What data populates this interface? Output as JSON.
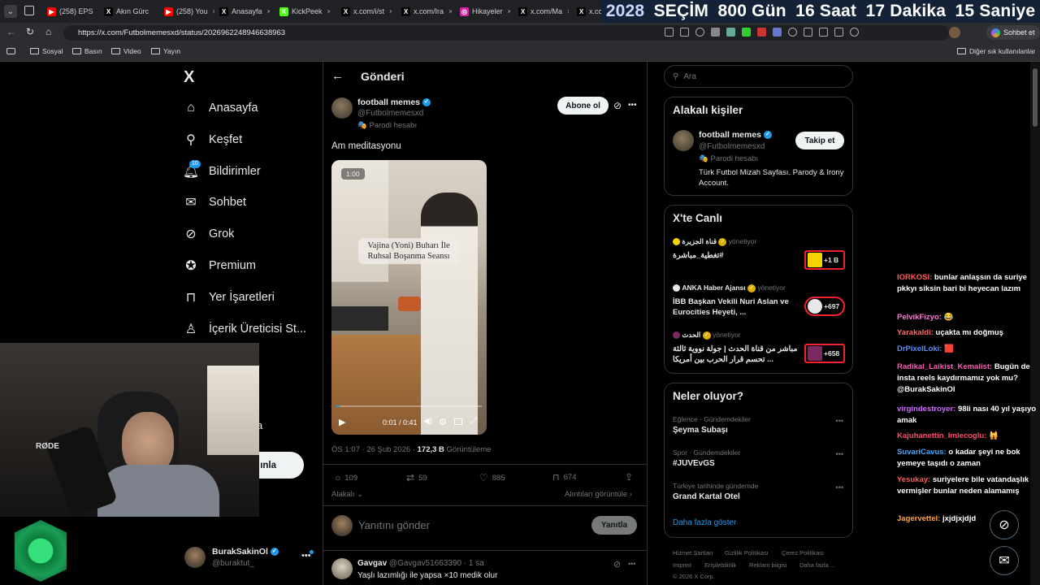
{
  "browser": {
    "tabs": [
      {
        "label": "(258) EPS",
        "fav": "▶",
        "color": "#ff0000"
      },
      {
        "label": "Akın Gürc",
        "fav": "X",
        "color": "#000"
      },
      {
        "label": "(258) You",
        "fav": "▶",
        "color": "#ff0000"
      },
      {
        "label": "Anasayfa",
        "fav": "X",
        "color": "#000"
      },
      {
        "label": "KickPeek",
        "fav": "K",
        "color": "#53fc18"
      },
      {
        "label": "x.com/i/st",
        "fav": "X",
        "color": "#000"
      },
      {
        "label": "x.com/Ira",
        "fav": "X",
        "color": "#000"
      },
      {
        "label": "Hikayeler",
        "fav": "◎",
        "color": "#d6249f"
      },
      {
        "label": "x.com/Ma",
        "fav": "X",
        "color": "#000"
      },
      {
        "label": "x.co",
        "fav": "X",
        "color": "#000"
      }
    ],
    "tab_close": "×",
    "countdown": [
      "2028",
      "SEÇİM",
      "800 Gün",
      "16 Saat",
      "17 Dakika",
      "15 Saniye"
    ],
    "url": "https://x.com/Futbolmemesxd/status/2026962248946638963",
    "copilot_label": "Sohbet et",
    "bookmarks": [
      "Sosyal",
      "Basın",
      "Video",
      "Yayın"
    ],
    "other_bookmarks": "Diğer sık kullanılanlar"
  },
  "nav": {
    "logo": "X",
    "items": [
      {
        "label": "Anasayfa",
        "icon": "home-icon"
      },
      {
        "label": "Keşfet",
        "icon": "search-icon"
      },
      {
        "label": "Bildirimler",
        "icon": "bell-icon",
        "badge": "10"
      },
      {
        "label": "Sohbet",
        "icon": "mail-icon"
      },
      {
        "label": "Grok",
        "icon": "grok-icon"
      },
      {
        "label": "Premium",
        "icon": "premium-icon"
      },
      {
        "label": "Yer İşaretleri",
        "icon": "bookmark-icon"
      },
      {
        "label": "İçerik Üreticisi St...",
        "icon": "creator-icon"
      }
    ],
    "post_button_partial": "ınla",
    "partial_text": "a",
    "account": {
      "name": "BurakSakinOl",
      "handle": "@buraktut_"
    }
  },
  "post_header": {
    "title": "Gönderi"
  },
  "tweet": {
    "author": "football memes",
    "handle": "@Futbolmemesxd",
    "parody": "Parodi hesabı",
    "subscribe": "Abone ol",
    "text": "Am meditasyonu",
    "video": {
      "badge": "1:00",
      "overlay": "Vajina (Yoni) Buharı İle Ruhsal Boşanma Seansı",
      "time": "0:01 / 0:41",
      "progress": 0.02
    },
    "meta_time": "ÖS 1:07 · 26 Şub 2026 · ",
    "meta_views": "172,3 B",
    "meta_views_label": " Görüntüleme",
    "stats": {
      "replies": "109",
      "reposts": "59",
      "likes": "885",
      "bookmarks": "674"
    },
    "related": "Alakalı",
    "quotes": "Alıntıları görüntüle"
  },
  "reply": {
    "placeholder": "Yanıtını gönder",
    "button": "Yanıtla"
  },
  "comment": {
    "name": "Gavgav",
    "handle": "@Gavgav51663390 · 1 sa",
    "text": "Yaşlı lazımlığı ile yapsa ×10 medik olur"
  },
  "sidebar": {
    "search_placeholder": "Ara",
    "related_title": "Alakalı kişiler",
    "related_person": {
      "name": "football memes",
      "handle": "@Futbolmemesxd",
      "parody": "Parodi hesabı",
      "bio": "Türk Futbol Mizah Sayfası. Parody & Irony Account.",
      "follow": "Takip et"
    },
    "live_title": "X'te Canlı",
    "live": [
      {
        "channel": "قناة الجزيرة",
        "role": "yönetiyor",
        "title": "تغطية_مباشرة#",
        "count": "+1 B"
      },
      {
        "channel": "ANKA Haber Ajansı",
        "role": "yönetiyor",
        "title": "İBB Başkan Vekili Nuri Aslan ve Eurocities Heyeti, ...",
        "count": "+697"
      },
      {
        "channel": "الحدث",
        "role": "yönetiyor",
        "title": "مباشر من قناة الحدث | جولة نووية ثالثة تحسم قرار الحرب بين أمريكا ...",
        "count": "+658"
      }
    ],
    "trends_title": "Neler oluyor?",
    "trends": [
      {
        "context": "Eğlence · Gündemdekiler",
        "title": "Şeyma Subaşı"
      },
      {
        "context": "Spor · Gündemdekiler",
        "title": "#JUVEvGS"
      },
      {
        "context": "Türkiye tarihinde gündemde",
        "title": "Grand Kartal Otel"
      }
    ],
    "show_more": "Daha fazla göster",
    "footer": [
      "Hizmet Şartları",
      "Gizlilik Politikası",
      "Çerez Politikası",
      "Imprint",
      "Erişilebilirlik",
      "Reklam bilgisi",
      "Daha fazla ...",
      "© 2026 X Corp."
    ]
  },
  "chat": [
    {
      "user": "IORKOSI:",
      "color": "#ff5a5a",
      "msg": "bunlar anlaşsın da suriye pkkyı siksin bari bi heyecan lazım"
    },
    {
      "user": "PelvikFizyo:",
      "color": "#ff7ad9",
      "msg": "😂"
    },
    {
      "user": "Yarakaldi:",
      "color": "#ff6b6b",
      "msg": "uçakta mı doğmuş"
    },
    {
      "user": "DrPixelLoki:",
      "color": "#5b8cff",
      "msg": "🟥"
    },
    {
      "user": "Radikal_Laikist_Kemalist:",
      "color": "#ff5ab4",
      "msg": "Bugün de insta reels kaydırmamız yok mu? @BurakSakinOl"
    },
    {
      "user": "virgindestroyer:",
      "color": "#d06bff",
      "msg": "98li nası 40 yıl yaşıyo amak"
    },
    {
      "user": "Kajuhanettin_Imlecoglu:",
      "color": "#ff4a6a",
      "msg": "🙀"
    },
    {
      "user": "SuvariCavus:",
      "color": "#3fa9ff",
      "msg": "o kadar şeyi ne bok yemeye taşıdı o zaman"
    },
    {
      "user": "Yesukay:",
      "color": "#ff5a5a",
      "msg": "suriyelere bile vatandaşlık vermişler bunlar neden alamamış"
    },
    {
      "user": "Jagervettel:",
      "color": "#ffa640",
      "msg": "jxjdjxjdjd"
    }
  ],
  "colors": {
    "accent": "#1d9bf0",
    "bg": "#000000",
    "border": "#2f3336",
    "muted": "#71767b",
    "live_red": "#f4212e"
  }
}
